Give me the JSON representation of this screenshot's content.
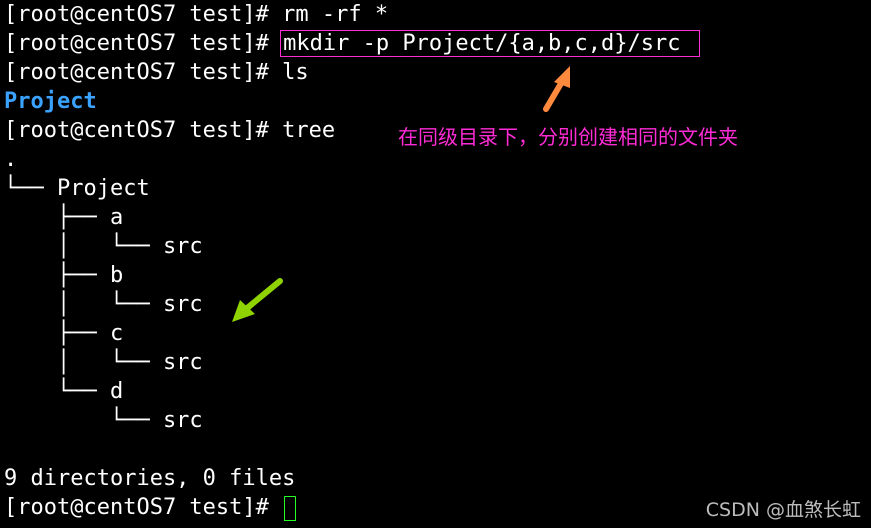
{
  "terminal": {
    "prompt": "[root@centOS7 test]#",
    "lines": [
      {
        "prompt": "[root@centOS7 test]#",
        "command": " rm -rf *"
      },
      {
        "prompt": "[root@centOS7 test]#",
        "command": "mkdir -p Project/{a,b,c,d}/src"
      },
      {
        "prompt": "[root@centOS7 test]#",
        "command": " ls"
      },
      {
        "output": "Project"
      },
      {
        "prompt": "[root@centOS7 test]#",
        "command": " tree"
      },
      {
        "output": "."
      },
      {
        "output": "└── Project"
      },
      {
        "output": "    ├── a"
      },
      {
        "output": "    │   └── src"
      },
      {
        "output": "    ├── b"
      },
      {
        "output": "    │   └── src"
      },
      {
        "output": "    ├── c"
      },
      {
        "output": "    │   └── src"
      },
      {
        "output": "    └── d"
      },
      {
        "output": "        └── src"
      },
      {
        "output": ""
      },
      {
        "output": "9 directories, 0 files"
      },
      {
        "prompt": "[root@centOS7 test]#",
        "command": " "
      }
    ]
  },
  "annotation": {
    "text": "在同级目录下，分别创建相同的文件夹",
    "color": "#ff2bd6"
  },
  "watermark": "CSDN @血煞长虹",
  "colors": {
    "background": "#000000",
    "text": "#ffffff",
    "directory": "#3aa3ff",
    "highlight_box": "#ff2bd6",
    "cursor": "#22ff22",
    "orange_arrow": "#ff8a3d",
    "green_arrow": "#8fd400"
  }
}
